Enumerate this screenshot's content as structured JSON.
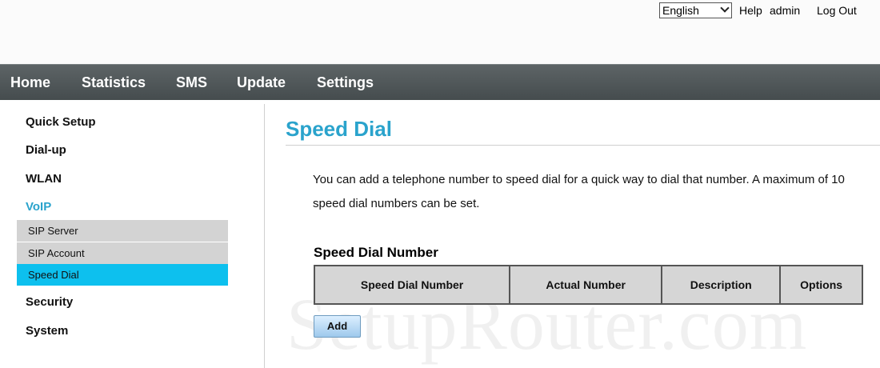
{
  "header": {
    "language": "English",
    "links": {
      "help": "Help",
      "user": "admin",
      "logout": "Log Out"
    }
  },
  "nav": {
    "home": "Home",
    "statistics": "Statistics",
    "sms": "SMS",
    "update": "Update",
    "settings": "Settings"
  },
  "sidebar": {
    "quick_setup": "Quick Setup",
    "dialup": "Dial-up",
    "wlan": "WLAN",
    "voip": "VoIP",
    "voip_items": {
      "sip_server": "SIP Server",
      "sip_account": "SIP Account",
      "speed_dial": "Speed Dial"
    },
    "security": "Security",
    "system": "System"
  },
  "main": {
    "title": "Speed Dial",
    "description": "You can add a telephone number to speed dial for a quick way to dial that number. A maximum of 10 speed dial numbers can be set.",
    "section_title": "Speed Dial Number",
    "table_headers": [
      "Speed Dial Number",
      "Actual Number",
      "Description",
      "Options"
    ],
    "add_button": "Add"
  },
  "watermark": "SetupRouter.com",
  "colors": {
    "accent": "#2aa3cc",
    "selected": "#0dc0ee",
    "nav_bg": "#4f5658"
  }
}
